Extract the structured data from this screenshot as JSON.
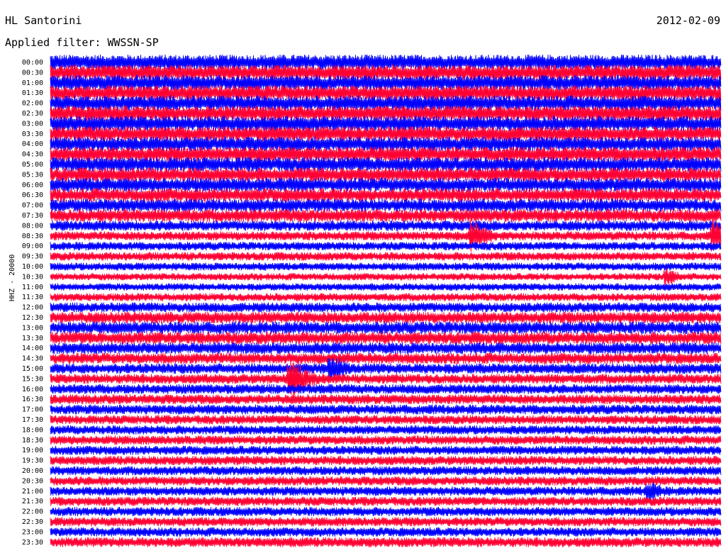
{
  "header": {
    "station": "HL Santorini",
    "date": "2012-02-09",
    "filter_label": "Applied filter: WWSSN-SP"
  },
  "colors": {
    "trace_a": "#0000ff",
    "trace_b": "#ff0033",
    "background": "#ffffff",
    "text": "#000000"
  },
  "chart_data": {
    "type": "line",
    "subtype": "helicorder",
    "title": "HL Santorini",
    "ylabel": "HHZ - 20000",
    "row_labels": [
      "00:00",
      "00:30",
      "01:00",
      "01:30",
      "02:00",
      "02:30",
      "03:00",
      "03:30",
      "04:00",
      "04:30",
      "05:00",
      "05:30",
      "06:00",
      "06:30",
      "07:00",
      "07:30",
      "08:00",
      "08:30",
      "09:00",
      "09:30",
      "10:00",
      "10:30",
      "11:00",
      "11:30",
      "12:00",
      "12:30",
      "13:00",
      "13:30",
      "14:00",
      "14:30",
      "15:00",
      "15:30",
      "16:00",
      "16:30",
      "17:00",
      "17:30",
      "18:00",
      "18:30",
      "19:00",
      "19:30",
      "20:00",
      "20:30",
      "21:00",
      "21:30",
      "22:00",
      "22:30",
      "23:00",
      "23:30"
    ],
    "row_duration_minutes": 30,
    "trace_colors_alternate": [
      "#0000ff",
      "#ff0033"
    ],
    "noise_level_by_row": [
      1.0,
      1.0,
      1.0,
      1.0,
      1.0,
      1.0,
      1.0,
      0.95,
      0.95,
      0.95,
      0.95,
      0.9,
      0.9,
      0.85,
      0.8,
      0.8,
      0.6,
      0.5,
      0.45,
      0.45,
      0.4,
      0.35,
      0.35,
      0.4,
      0.55,
      0.7,
      0.75,
      0.75,
      0.7,
      0.65,
      0.6,
      0.55,
      0.55,
      0.55,
      0.55,
      0.5,
      0.5,
      0.5,
      0.5,
      0.5,
      0.5,
      0.5,
      0.5,
      0.5,
      0.5,
      0.5,
      0.5,
      0.55
    ],
    "events": [
      {
        "row": "08:30",
        "minute": 18.9,
        "amplitude": 3.5
      },
      {
        "row": "08:30",
        "minute": 29.7,
        "amplitude": 3.5
      },
      {
        "row": "10:30",
        "minute": 27.6,
        "amplitude": 2.5
      },
      {
        "row": "15:30",
        "minute": 10.8,
        "amplitude": 4.5
      },
      {
        "row": "15:00",
        "minute": 12.6,
        "amplitude": 3.0
      },
      {
        "row": "21:00",
        "minute": 26.8,
        "amplitude": 2.5
      }
    ]
  }
}
